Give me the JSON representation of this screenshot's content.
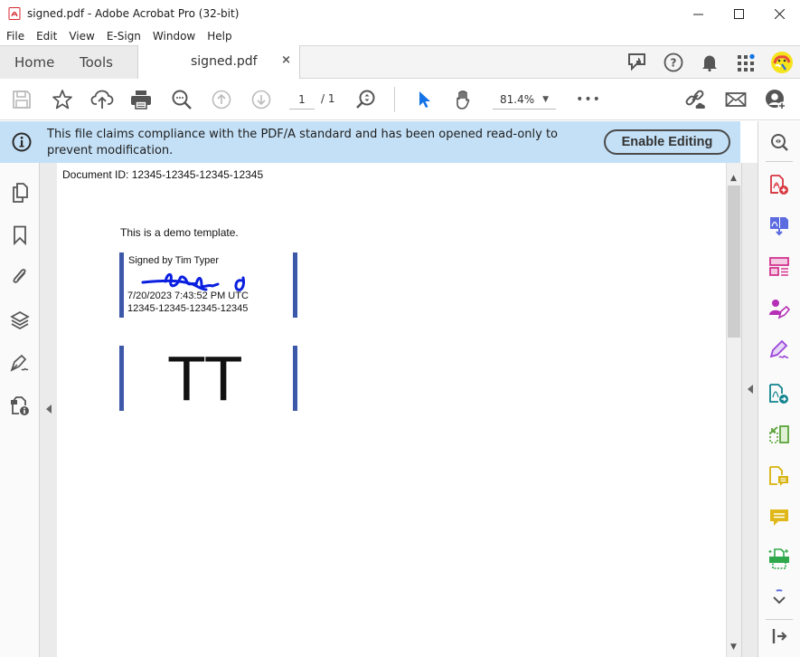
{
  "window": {
    "title": "signed.pdf - Adobe Acrobat Pro (32-bit)",
    "controls": [
      "minimize",
      "maximize",
      "close"
    ]
  },
  "menu": [
    "File",
    "Edit",
    "View",
    "E-Sign",
    "Window",
    "Help"
  ],
  "tabs": {
    "home": "Home",
    "tools": "Tools",
    "document": "signed.pdf",
    "close_glyph": "×"
  },
  "tab_right_icons": [
    "feedback-icon",
    "help-icon",
    "notifications-icon",
    "apps-icon",
    "user-avatar"
  ],
  "toolbar": {
    "page_current": "1",
    "page_total": "/ 1",
    "zoom": "81.4%",
    "more": "•••"
  },
  "banner": {
    "message": "This file claims compliance with the PDF/A standard and has been opened read-only to prevent modification.",
    "button": "Enable Editing",
    "background": "#c4e0f6"
  },
  "document": {
    "doc_id_line": "Document ID: 12345-12345-12345-12345",
    "intro": "This is a demo template.",
    "signature": {
      "signed_by": "Signed by Tim Typer",
      "timestamp": "7/20/2023 7:43:52 PM UTC",
      "id": "12345-12345-12345-12345",
      "ink_color": "#0a1fe0"
    },
    "initials": "TT",
    "bar_color": "#3c58a8"
  },
  "left_rail": [
    "page-thumbnails",
    "bookmarks",
    "attachments",
    "layers",
    "signatures",
    "document-properties"
  ],
  "right_rail": [
    "zoom-tool",
    "create-pdf",
    "combine-files",
    "organize-pages",
    "request-signatures",
    "fill-and-sign",
    "export-pdf",
    "compress-pdf",
    "edit-comment",
    "comment",
    "print-production",
    "more-tools",
    "collapse-panel"
  ],
  "accent": "#1473e6"
}
